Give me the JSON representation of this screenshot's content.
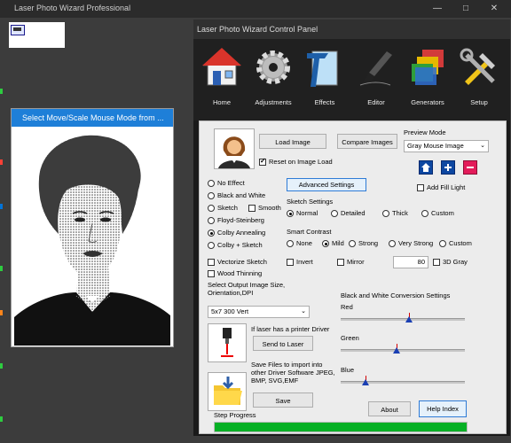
{
  "window": {
    "title": "Laser Photo Wizard Professional"
  },
  "image_panel": {
    "header": "Select Move/Scale Mouse Mode from ..."
  },
  "control_panel": {
    "title": "Laser Photo Wizard Control Panel",
    "toolbar": [
      {
        "label": "Home",
        "icon": "house-icon"
      },
      {
        "label": "Adjustments",
        "icon": "gear-icon"
      },
      {
        "label": "Effects",
        "icon": "effects-icon"
      },
      {
        "label": "Editor",
        "icon": "brush-icon"
      },
      {
        "label": "Generators",
        "icon": "layers-icon"
      },
      {
        "label": "Setup",
        "icon": "tools-icon"
      }
    ],
    "load_image_label": "Load Image",
    "compare_images_label": "Compare Images",
    "reset_on_load_label": "Reset on Image Load",
    "reset_on_load_checked": true,
    "preview_mode": {
      "label": "Preview Mode",
      "value": "Gray Mouse Image"
    },
    "add_fill_light_label": "Add Fill Light",
    "effects": [
      {
        "label": "No Effect",
        "selected": false
      },
      {
        "label": "Black and White",
        "selected": false
      },
      {
        "label": "Sketch",
        "selected": false
      },
      {
        "label": "Floyd-Steinberg",
        "selected": false
      },
      {
        "label": "Colby Annealing",
        "selected": true
      },
      {
        "label": "Colby + Sketch",
        "selected": false
      }
    ],
    "smooth_label": "Smooth",
    "advanced_settings_label": "Advanced Settings",
    "sketch_settings": {
      "label": "Sketch Settings",
      "options": [
        "Normal",
        "Detailed",
        "Thick",
        "Custom"
      ],
      "selected": "Normal"
    },
    "smart_contrast": {
      "label": "Smart Contrast",
      "options": [
        "None",
        "Mild",
        "Strong",
        "Very Strong",
        "Custom"
      ],
      "selected": "Mild"
    },
    "vectorize_sketch_label": "Vectorize Sketch",
    "invert_label": "Invert",
    "mirror_label": "Mirror",
    "gray_value": "80",
    "gray_3d_label": "3D Gray",
    "wood_thinning_label": "Wood Thinning",
    "output_size_label": "Select Output Image Size, Orientation,DPI",
    "output_size_value": "5x7 300 Vert",
    "bw_conversion": {
      "label": "Black and White Conversion Settings",
      "channels": [
        {
          "name": "Red",
          "value": 0.55
        },
        {
          "name": "Green",
          "value": 0.45
        },
        {
          "name": "Blue",
          "value": 0.2
        }
      ]
    },
    "printer_driver_label": "If laser has a printer Driver",
    "send_to_laser_label": "Send to Laser",
    "save_files_label": "Save Files to import into other Driver Software JPEG, BMP, SVG,EMF",
    "save_label": "Save",
    "about_label": "About",
    "help_index_label": "Help Index",
    "step_progress_label": "Step Progress",
    "progress": 1.0
  }
}
